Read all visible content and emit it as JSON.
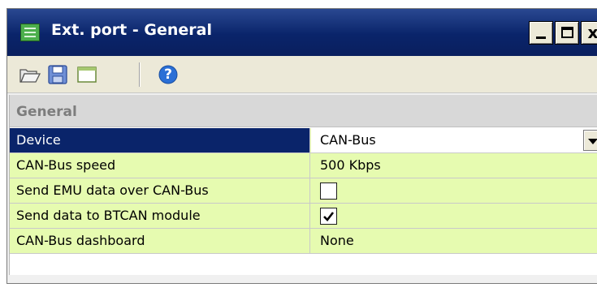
{
  "window": {
    "title": "Ext. port - General",
    "icon": "grid-window-icon",
    "controls": {
      "minimize_icon": "minimize-icon",
      "maximize_icon": "maximize-icon",
      "close_label": "x"
    }
  },
  "toolbar": {
    "buttons": [
      {
        "name": "open",
        "icon": "folder-open-icon"
      },
      {
        "name": "save",
        "icon": "save-disk-icon"
      },
      {
        "name": "view",
        "icon": "window-view-icon"
      },
      {
        "name": "help",
        "icon": "help-icon",
        "label": "?"
      }
    ]
  },
  "grid": {
    "section": "General",
    "rows": [
      {
        "name": "Device",
        "value": "CAN-Bus",
        "editor": "dropdown",
        "selected": true
      },
      {
        "name": "CAN-Bus speed",
        "value": "500 Kbps"
      },
      {
        "name": "Send EMU data over CAN-Bus",
        "checked": false,
        "editor": "checkbox"
      },
      {
        "name": "Send data to BTCAN module",
        "checked": true,
        "editor": "checkbox"
      },
      {
        "name": "CAN-Bus dashboard",
        "value": "None"
      }
    ]
  },
  "colors": {
    "titlebar": "#0a246a",
    "row_background": "#e6fbb0",
    "selected_row": "#0a246a",
    "section_background": "#d8d8d8"
  }
}
